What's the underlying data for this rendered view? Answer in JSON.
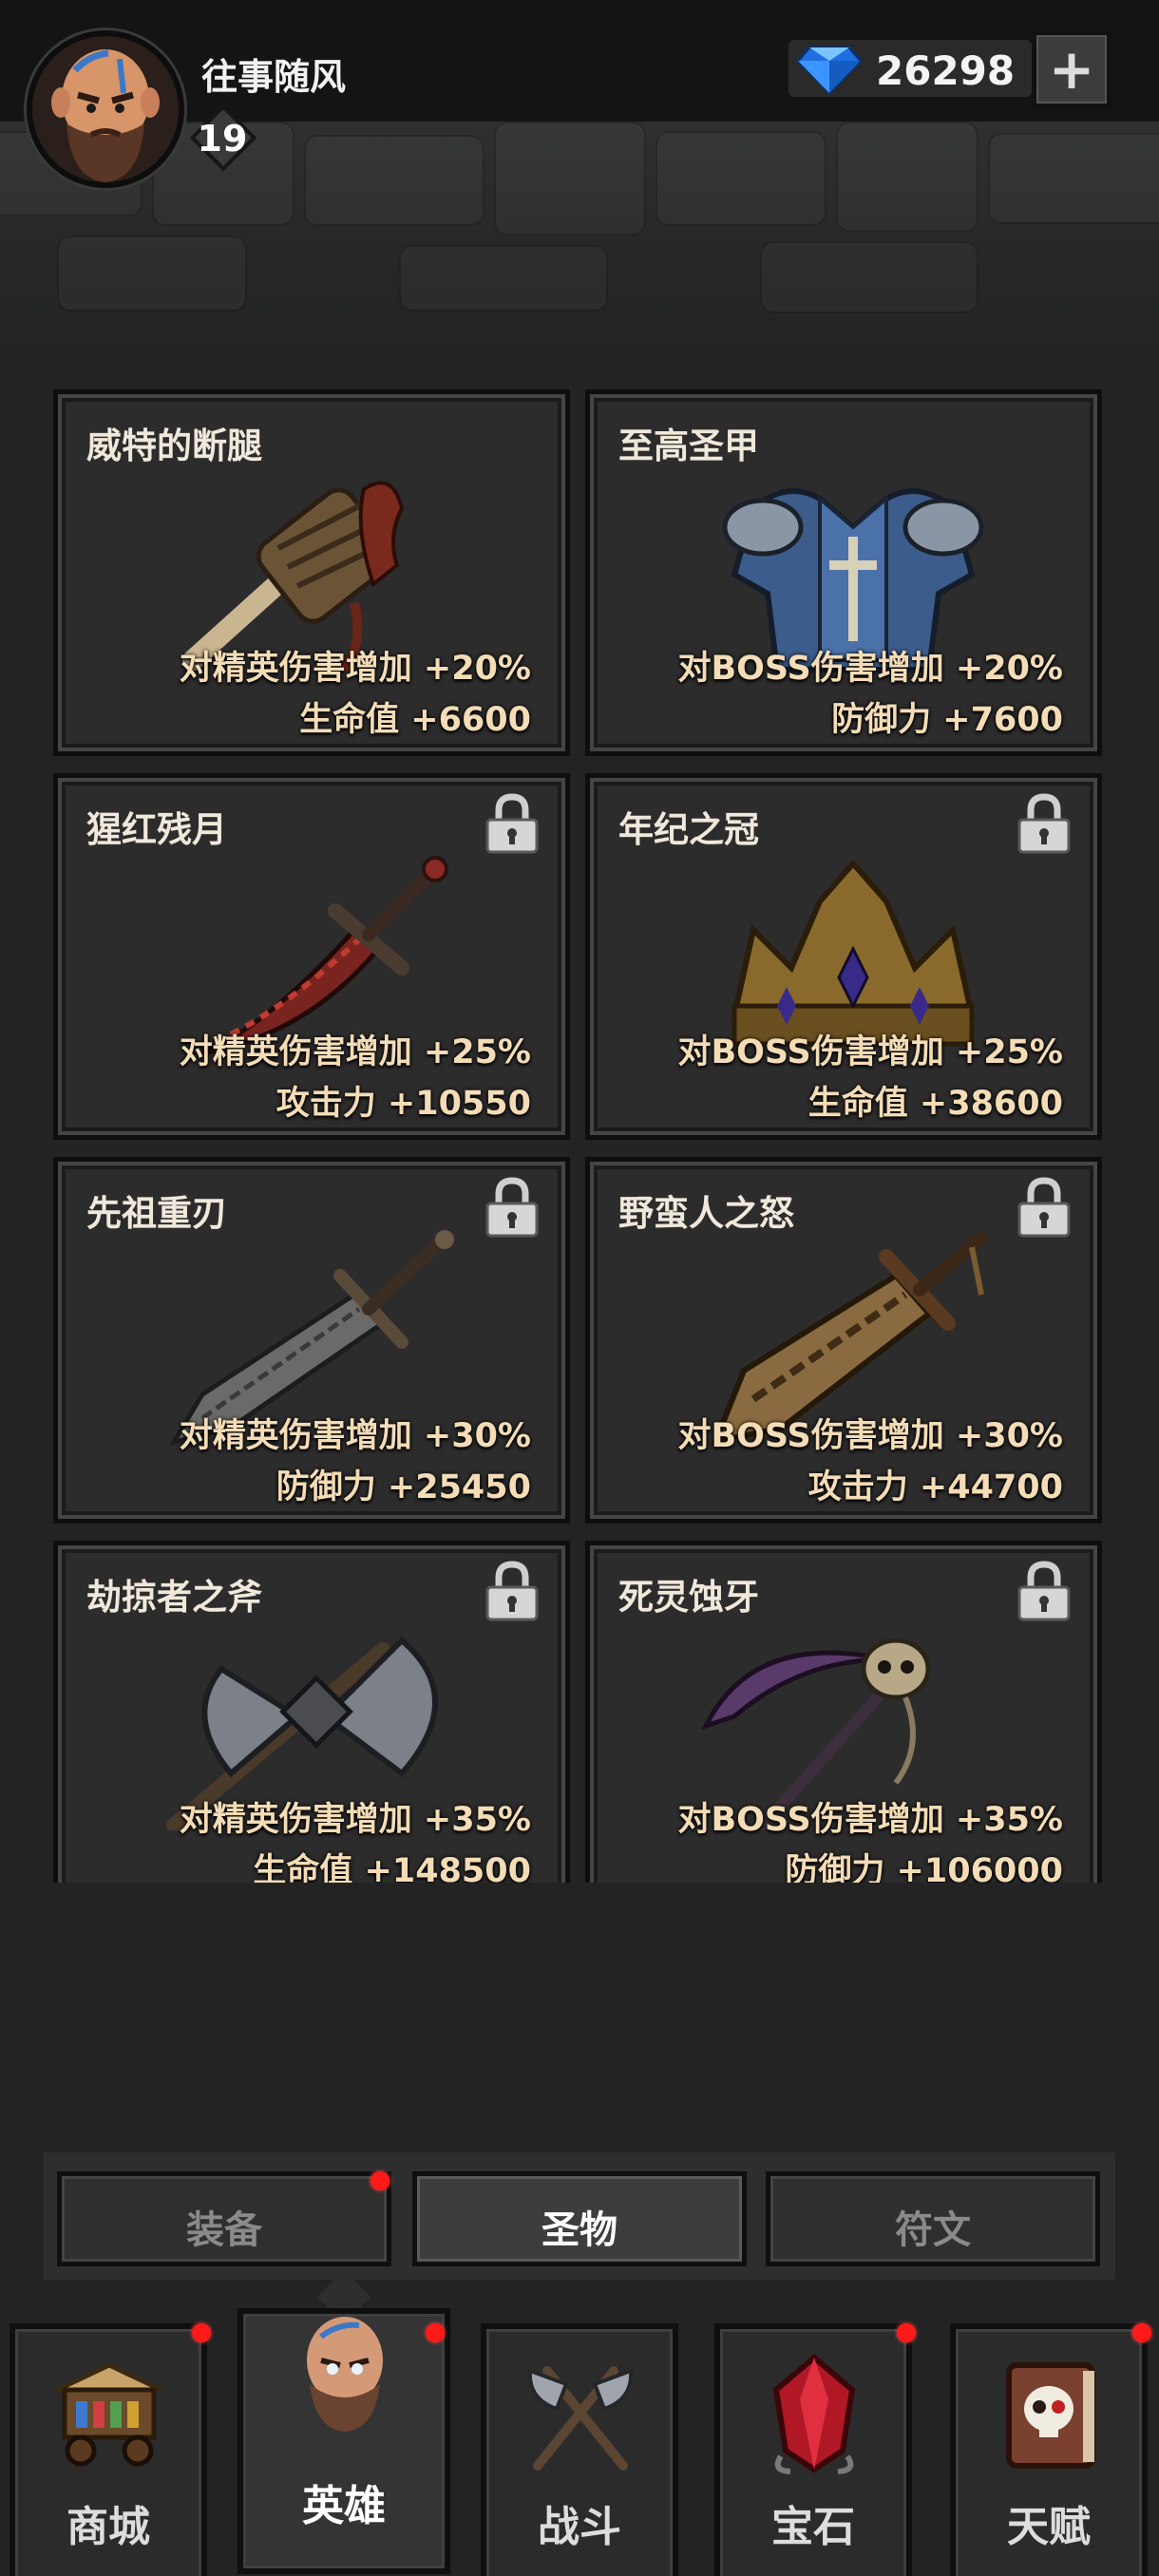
{
  "header": {
    "player_name": "往事随风",
    "level": "19",
    "gems": "26298",
    "add_label": "+"
  },
  "relics": [
    {
      "name": "威特的断腿",
      "stat1": "对精英伤害增加 +20%",
      "stat2": "生命值 +6600",
      "locked": false,
      "icon": "broken-leg-club-icon"
    },
    {
      "name": "至高圣甲",
      "stat1": "对BOSS伤害增加 +20%",
      "stat2": "防御力 +7600",
      "locked": false,
      "icon": "holy-armor-icon"
    },
    {
      "name": "猩红残月",
      "stat1": "对精英伤害增加 +25%",
      "stat2": "攻击力 +10550",
      "locked": true,
      "icon": "crimson-blade-icon"
    },
    {
      "name": "年纪之冠",
      "stat1": "对BOSS伤害增加 +25%",
      "stat2": "生命值 +38600",
      "locked": true,
      "icon": "crown-icon"
    },
    {
      "name": "先祖重刃",
      "stat1": "对精英伤害增加 +30%",
      "stat2": "防御力 +25450",
      "locked": true,
      "icon": "ancestral-sword-icon"
    },
    {
      "name": "野蛮人之怒",
      "stat1": "对BOSS伤害增加 +30%",
      "stat2": "攻击力 +44700",
      "locked": true,
      "icon": "barbarian-greatsword-icon"
    },
    {
      "name": "劫掠者之斧",
      "stat1": "对精英伤害增加 +35%",
      "stat2": "生命值 +148500",
      "locked": true,
      "icon": "double-axe-icon"
    },
    {
      "name": "死灵蚀牙",
      "stat1": "对BOSS伤害增加 +35%",
      "stat2": "防御力 +106000",
      "locked": true,
      "icon": "skull-scythe-icon"
    }
  ],
  "subtabs": [
    {
      "label": "装备",
      "active": false,
      "dot": true
    },
    {
      "label": "圣物",
      "active": true,
      "dot": false
    },
    {
      "label": "符文",
      "active": false,
      "dot": false
    }
  ],
  "nav": [
    {
      "label": "商城",
      "icon": "shop-cart-icon",
      "active": false,
      "dot": true
    },
    {
      "label": "英雄",
      "icon": "hero-portrait-icon",
      "active": true,
      "dot": true
    },
    {
      "label": "战斗",
      "icon": "crossed-axes-icon",
      "active": false,
      "dot": false
    },
    {
      "label": "宝石",
      "icon": "red-gem-icon",
      "active": false,
      "dot": true
    },
    {
      "label": "天赋",
      "icon": "skull-book-icon",
      "active": false,
      "dot": true
    }
  ],
  "colors": {
    "background": "#232323",
    "stat_text": "#f4dcb6",
    "badge": "#ff1a1a",
    "gem": "#2f8fff"
  }
}
